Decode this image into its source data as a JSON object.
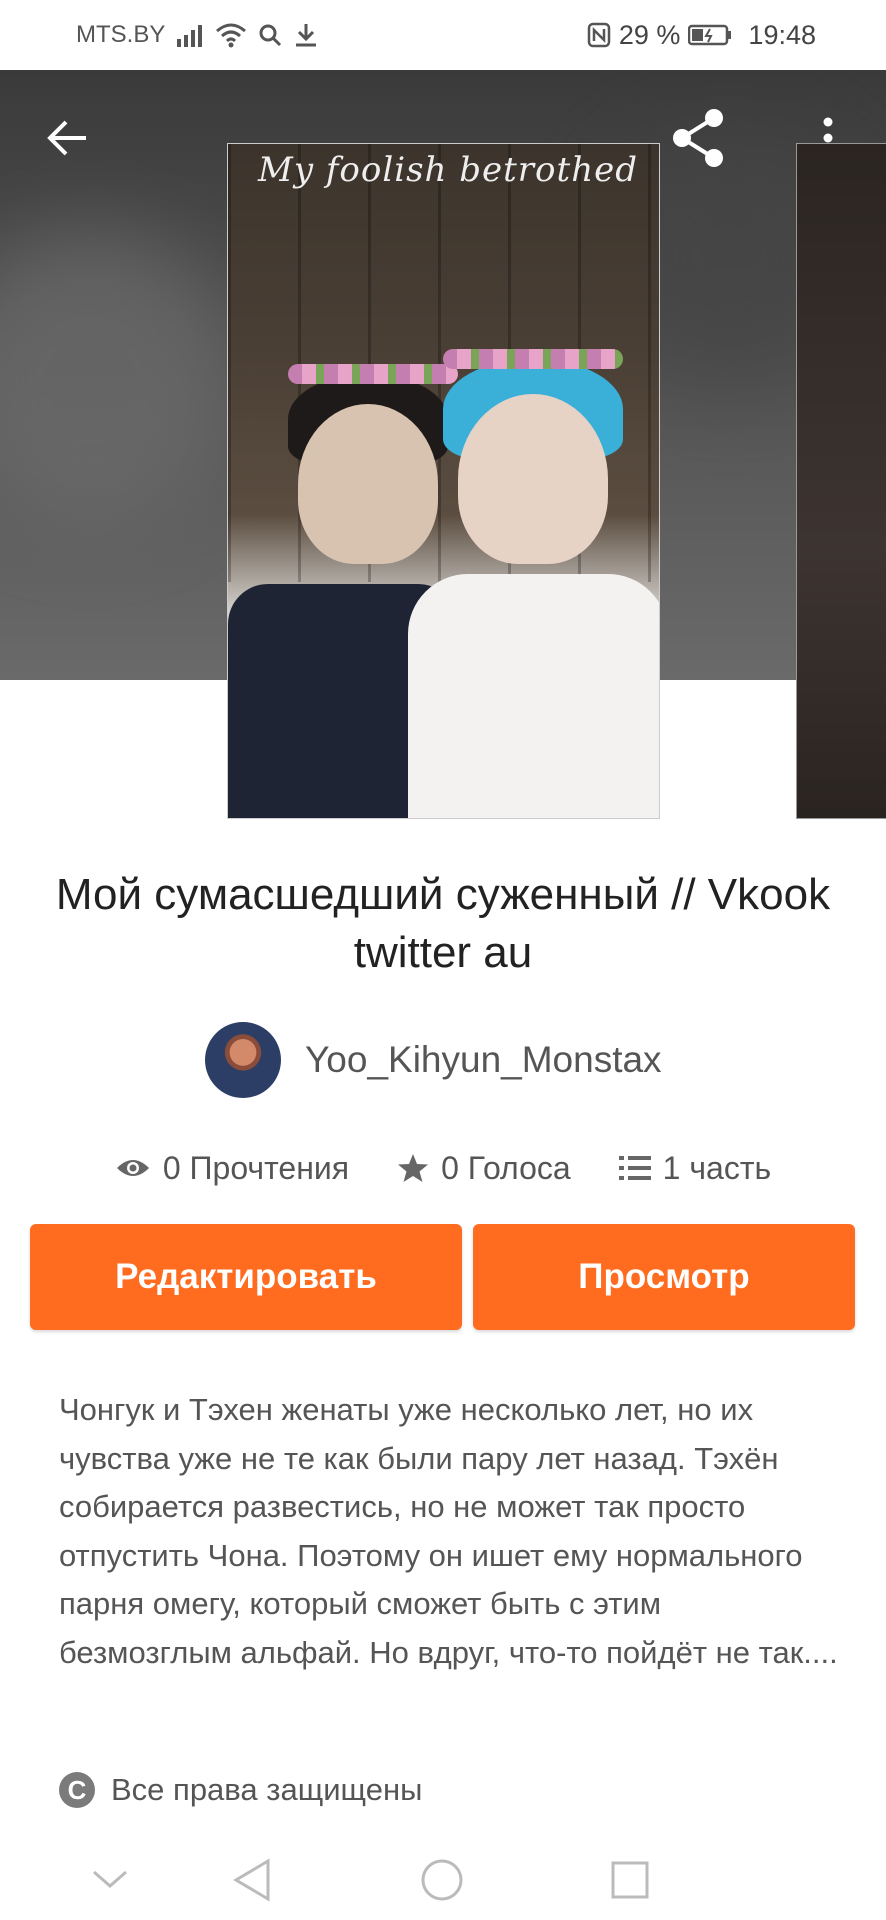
{
  "status_bar": {
    "carrier": "MTS.BY",
    "battery": "29 %",
    "time": "19:48",
    "icons": [
      "signal-icon",
      "wifi-icon",
      "search-icon",
      "download-icon",
      "nfc-icon",
      "battery-icon"
    ]
  },
  "header": {
    "back_icon": "arrow-left-icon",
    "share_icon": "share-icon",
    "more_icon": "more-vertical-icon"
  },
  "cover": {
    "title": "My foolish betrothed"
  },
  "story": {
    "title": "Мой сумасшедший суженный // Vkook twitter au",
    "author": "Yoo_Kihyun_Monstax"
  },
  "stats": {
    "reads": "0 Прочтения",
    "votes": "0 Голоса",
    "parts": "1 часть"
  },
  "actions": {
    "edit_label": "Редактировать",
    "view_label": "Просмотр",
    "accent_color": "#ff6b1f"
  },
  "description": "Чонгук и Тэхен женаты уже несколько лет, но их чувства уже не те как были пару лет назад. Тэхён собирается развестись, но не может так просто отпустить Чона. Поэтому он ишет ему нормального парня омегу, который сможет быть с этим безмозглым альфай. Но вдруг, что-то пойдёт не так....",
  "copyright": {
    "label": "Все права защищены",
    "icon": "copyright-icon"
  },
  "nav_bar": {
    "icons": [
      "chevron-down-icon",
      "back-triangle-icon",
      "home-circle-icon",
      "recents-square-icon"
    ]
  }
}
